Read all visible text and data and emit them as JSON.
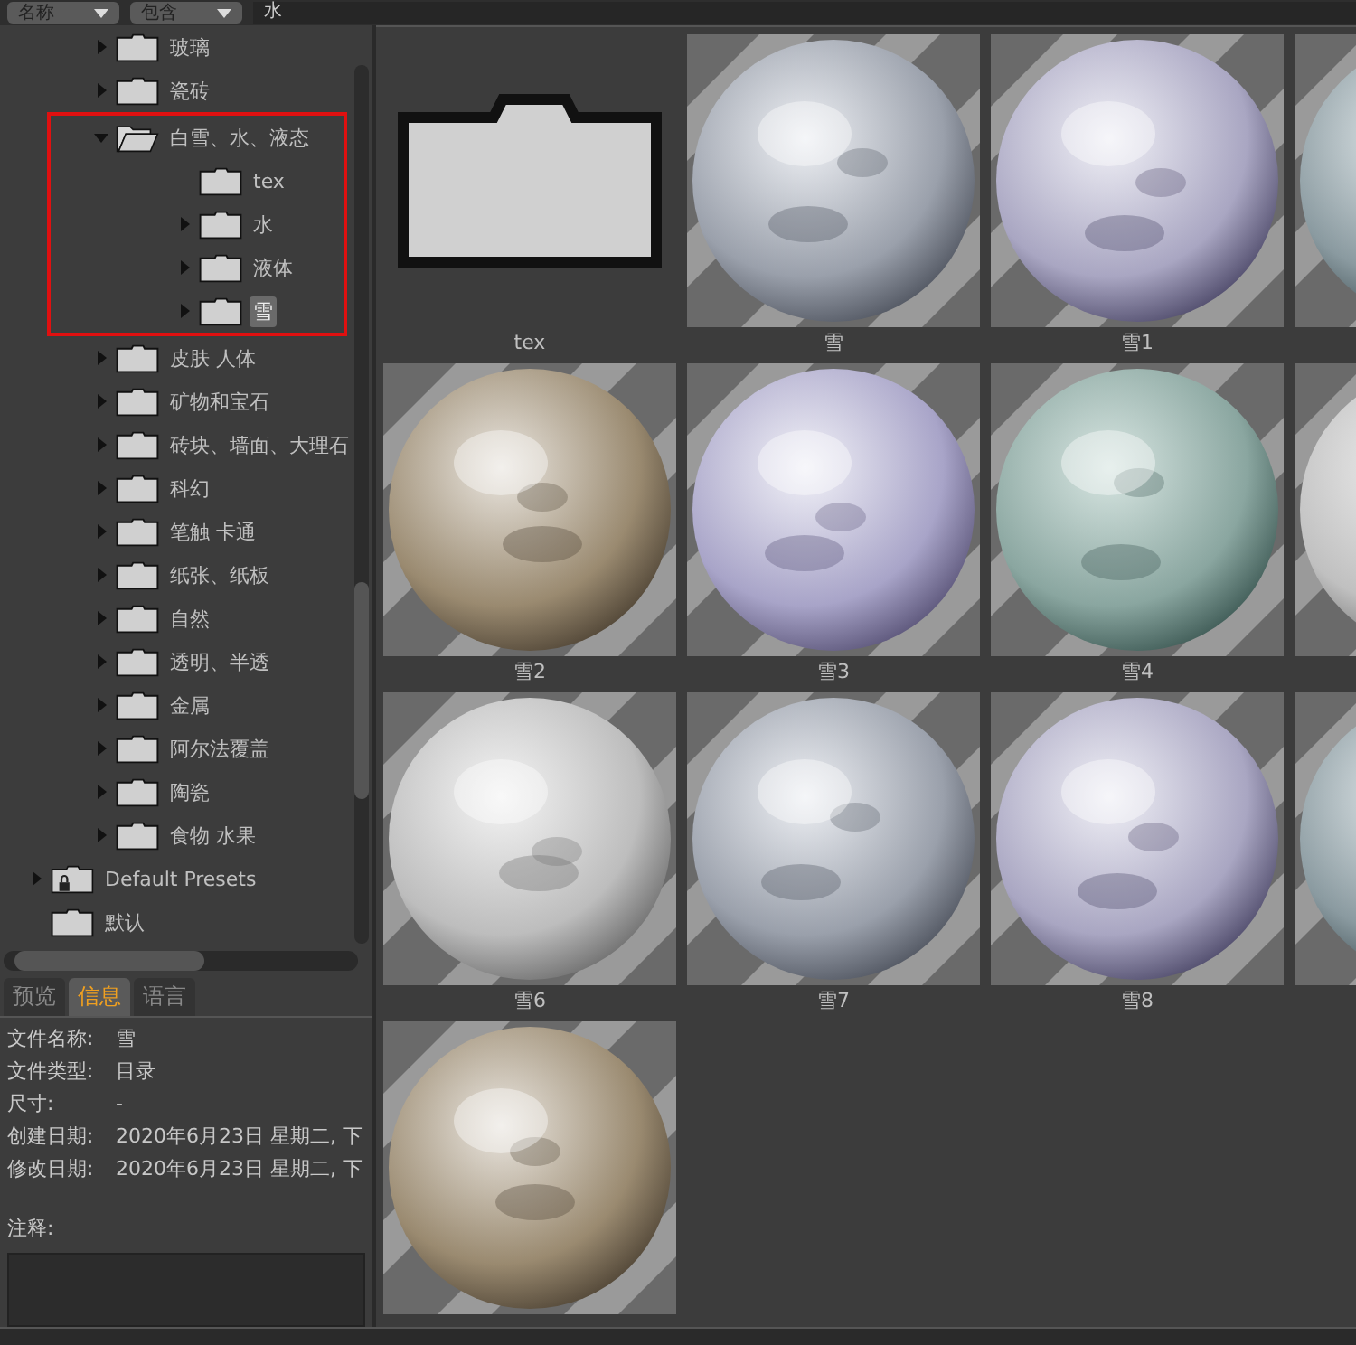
{
  "toolbar": {
    "sort_dropdown": "名称",
    "match_dropdown": "包含",
    "search_value": "水"
  },
  "tree": [
    {
      "kind": "continued",
      "children": [
        {
          "kind": "folder",
          "label": "玻璃",
          "expandable": true,
          "expanded": false,
          "selected": false,
          "highlighted": false
        },
        {
          "kind": "folder",
          "label": "瓷砖",
          "expandable": true,
          "expanded": false,
          "selected": false,
          "highlighted": false
        },
        {
          "kind": "folder",
          "label": "白雪、水、液态",
          "expandable": true,
          "expanded": true,
          "selected": false,
          "highlighted": true,
          "children": [
            {
              "kind": "folder",
              "label": "tex",
              "expandable": false,
              "selected": false,
              "highlighted": false
            },
            {
              "kind": "folder",
              "label": "水",
              "expandable": true,
              "expanded": false,
              "selected": false,
              "highlighted": false
            },
            {
              "kind": "folder",
              "label": "液体",
              "expandable": true,
              "expanded": false,
              "selected": false,
              "highlighted": false
            },
            {
              "kind": "folder",
              "label": "雪",
              "expandable": true,
              "expanded": false,
              "selected": true,
              "highlighted": false
            }
          ]
        },
        {
          "kind": "folder",
          "label": "皮肤 人体",
          "expandable": true,
          "expanded": false,
          "selected": false,
          "highlighted": false
        },
        {
          "kind": "folder",
          "label": "矿物和宝石",
          "expandable": true,
          "expanded": false,
          "selected": false,
          "highlighted": false
        },
        {
          "kind": "folder",
          "label": "砖块、墙面、大理石",
          "expandable": true,
          "expanded": false,
          "selected": false,
          "highlighted": false
        },
        {
          "kind": "folder",
          "label": "科幻",
          "expandable": true,
          "expanded": false,
          "selected": false,
          "highlighted": false
        },
        {
          "kind": "folder",
          "label": "笔触 卡通",
          "expandable": true,
          "expanded": false,
          "selected": false,
          "highlighted": false
        },
        {
          "kind": "folder",
          "label": "纸张、纸板",
          "expandable": true,
          "expanded": false,
          "selected": false,
          "highlighted": false
        },
        {
          "kind": "folder",
          "label": "自然",
          "expandable": true,
          "expanded": false,
          "selected": false,
          "highlighted": false
        },
        {
          "kind": "folder",
          "label": "透明、半透",
          "expandable": true,
          "expanded": false,
          "selected": false,
          "highlighted": false
        },
        {
          "kind": "folder",
          "label": "金属",
          "expandable": true,
          "expanded": false,
          "selected": false,
          "highlighted": false
        },
        {
          "kind": "folder",
          "label": "阿尔法覆盖",
          "expandable": true,
          "expanded": false,
          "selected": false,
          "highlighted": false
        },
        {
          "kind": "folder",
          "label": "陶瓷",
          "expandable": true,
          "expanded": false,
          "selected": false,
          "highlighted": false
        },
        {
          "kind": "folder",
          "label": "食物 水果",
          "expandable": true,
          "expanded": false,
          "selected": false,
          "highlighted": false
        }
      ]
    },
    {
      "kind": "preset",
      "label": "Default Presets",
      "expandable": true,
      "expanded": false,
      "selected": false,
      "highlighted": false
    },
    {
      "kind": "folder",
      "label": "默认",
      "expandable": false,
      "selected": false,
      "highlighted": false
    }
  ],
  "tabs": [
    {
      "label": "预览",
      "selected": false
    },
    {
      "label": "信息",
      "selected": true
    },
    {
      "label": "语言",
      "selected": false
    }
  ],
  "info": [
    {
      "label": "文件名称:",
      "value": "雪"
    },
    {
      "label": "文件类型:",
      "value": "目录"
    },
    {
      "label": "尺寸:",
      "value": "-"
    },
    {
      "label": "创建日期:",
      "value": "2020年6月23日 星期二, 下"
    },
    {
      "label": "修改日期:",
      "value": "2020年6月23日 星期二, 下"
    }
  ],
  "notes": {
    "label": "注释:"
  },
  "grid": [
    {
      "kind": "folder",
      "label": "tex"
    },
    {
      "kind": "material",
      "label": "雪"
    },
    {
      "kind": "material",
      "label": "雪1"
    },
    {
      "kind": "material"
    },
    {
      "kind": "material",
      "label": "雪2"
    },
    {
      "kind": "material",
      "label": "雪3"
    },
    {
      "kind": "material",
      "label": "雪4"
    },
    {
      "kind": "material"
    },
    {
      "kind": "material",
      "label": "雪6"
    },
    {
      "kind": "material",
      "label": "雪7"
    },
    {
      "kind": "material",
      "label": "雪8"
    },
    {
      "kind": "material"
    },
    {
      "kind": "material"
    }
  ]
}
